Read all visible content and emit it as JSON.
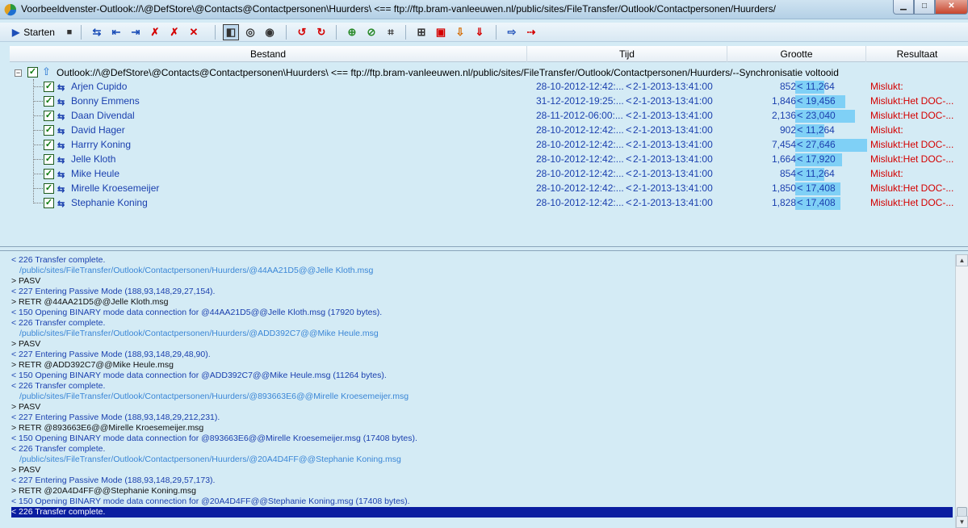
{
  "window": {
    "title": "Voorbeeldvenster-Outlook://\\@DefStore\\@Contacts@Contactpersonen\\Huurders\\ <== ftp://ftp.bram-vanleeuwen.nl/public/sites/FileTransfer/Outlook/Contactpersonen/Huurders/",
    "min_glyph": "▁",
    "max_glyph": "□",
    "close_glyph": "✕"
  },
  "toolbar": {
    "start_label": "Starten",
    "start_glyph": "▶",
    "stop_glyph": "■",
    "icons": [
      {
        "glyph": "⇆",
        "color": "#1d4fb8"
      },
      {
        "glyph": "⇤",
        "color": "#1d4fb8"
      },
      {
        "glyph": "⇥",
        "color": "#1d4fb8"
      },
      {
        "glyph": "✗",
        "color": "#d40000"
      },
      {
        "glyph": "✗",
        "color": "#d40000"
      },
      {
        "glyph": "✕",
        "color": "#d40000"
      },
      {
        "glyph": "◧",
        "color": "#333333"
      },
      {
        "glyph": "◎",
        "color": "#333333"
      },
      {
        "glyph": "◉",
        "color": "#333333"
      },
      {
        "glyph": "↺",
        "color": "#d40000"
      },
      {
        "glyph": "↻",
        "color": "#d40000"
      },
      {
        "glyph": "⊕",
        "color": "#2a8a2a"
      },
      {
        "glyph": "⊘",
        "color": "#2a8a2a"
      },
      {
        "glyph": "⌗",
        "color": "#333333"
      },
      {
        "glyph": "⊞",
        "color": "#333333"
      },
      {
        "glyph": "▣",
        "color": "#d40000"
      },
      {
        "glyph": "⇩",
        "color": "#d46a00"
      },
      {
        "glyph": "⇓",
        "color": "#d40000"
      },
      {
        "glyph": "⇨",
        "color": "#1d4fb8"
      },
      {
        "glyph": "⇢",
        "color": "#d40000"
      }
    ]
  },
  "columns": {
    "bestand": "Bestand",
    "tijd": "Tijd",
    "grootte": "Grootte",
    "resultaat": "Resultaat"
  },
  "tree": {
    "root_label": "Outlook://\\@DefStore\\@Contacts@Contactpersonen\\Huurders\\ <== ftp://ftp.bram-vanleeuwen.nl/public/sites/FileTransfer/Outlook/Contactpersonen/Huurders/--Synchronisatie voltooid",
    "expander": "−",
    "check": "✓",
    "up_arrow": "⇧",
    "sync_glyph": "⇆",
    "lt_glyph": "<",
    "rows": [
      {
        "name": "Arjen Cupido",
        "time_local": "28-10-2012-12:42:...",
        "time_remote": "2-1-2013-13:41:00",
        "size_local": "852",
        "size_remote": "11,264",
        "result": "Mislukt:",
        "fill": 0.41
      },
      {
        "name": "Bonny Emmens",
        "time_local": "31-12-2012-19:25:...",
        "time_remote": "2-1-2013-13:41:00",
        "size_local": "1,846",
        "size_remote": "19,456",
        "result": "Mislukt:Het DOC-...",
        "fill": 0.7
      },
      {
        "name": "Daan Divendal",
        "time_local": "28-11-2012-06:00:...",
        "time_remote": "2-1-2013-13:41:00",
        "size_local": "2,136",
        "size_remote": "23,040",
        "result": "Mislukt:Het DOC-...",
        "fill": 0.83
      },
      {
        "name": "David Hager",
        "time_local": "28-10-2012-12:42:...",
        "time_remote": "2-1-2013-13:41:00",
        "size_local": "902",
        "size_remote": "11,264",
        "result": "Mislukt:",
        "fill": 0.41
      },
      {
        "name": "Harrry Koning",
        "time_local": "28-10-2012-12:42:...",
        "time_remote": "2-1-2013-13:41:00",
        "size_local": "7,454",
        "size_remote": "27,646",
        "result": "Mislukt:Het DOC-...",
        "fill": 1.0
      },
      {
        "name": "Jelle Kloth",
        "time_local": "28-10-2012-12:42:...",
        "time_remote": "2-1-2013-13:41:00",
        "size_local": "1,664",
        "size_remote": "17,920",
        "result": "Mislukt:Het DOC-...",
        "fill": 0.65
      },
      {
        "name": "Mike Heule",
        "time_local": "28-10-2012-12:42:...",
        "time_remote": "2-1-2013-13:41:00",
        "size_local": "854",
        "size_remote": "11,264",
        "result": "Mislukt:",
        "fill": 0.41
      },
      {
        "name": "Mirelle Kroesemeijer",
        "time_local": "28-10-2012-12:42:...",
        "time_remote": "2-1-2013-13:41:00",
        "size_local": "1,850",
        "size_remote": "17,408",
        "result": "Mislukt:Het DOC-...",
        "fill": 0.63
      },
      {
        "name": "Stephanie Koning",
        "time_local": "28-10-2012-12:42:...",
        "time_remote": "2-1-2013-13:41:00",
        "size_local": "1,828",
        "size_remote": "17,408",
        "result": "Mislukt:Het DOC-...",
        "fill": 0.63
      }
    ]
  },
  "log": [
    {
      "kind": "resp",
      "text": "< 226 Transfer complete."
    },
    {
      "kind": "path",
      "text": "/public/sites/FileTransfer/Outlook/Contactpersonen/Huurders/@44AA21D5@@Jelle Kloth.msg"
    },
    {
      "kind": "cmd",
      "text": "> PASV"
    },
    {
      "kind": "resp",
      "text": "< 227 Entering Passive Mode (188,93,148,29,27,154)."
    },
    {
      "kind": "cmd",
      "text": "> RETR @44AA21D5@@Jelle Kloth.msg"
    },
    {
      "kind": "resp",
      "text": "< 150 Opening BINARY mode data connection for @44AA21D5@@Jelle Kloth.msg (17920 bytes)."
    },
    {
      "kind": "resp",
      "text": "< 226 Transfer complete."
    },
    {
      "kind": "path",
      "text": "/public/sites/FileTransfer/Outlook/Contactpersonen/Huurders/@ADD392C7@@Mike Heule.msg"
    },
    {
      "kind": "cmd",
      "text": "> PASV"
    },
    {
      "kind": "resp",
      "text": "< 227 Entering Passive Mode (188,93,148,29,48,90)."
    },
    {
      "kind": "cmd",
      "text": "> RETR @ADD392C7@@Mike Heule.msg"
    },
    {
      "kind": "resp",
      "text": "< 150 Opening BINARY mode data connection for @ADD392C7@@Mike Heule.msg (11264 bytes)."
    },
    {
      "kind": "resp",
      "text": "< 226 Transfer complete."
    },
    {
      "kind": "path",
      "text": "/public/sites/FileTransfer/Outlook/Contactpersonen/Huurders/@893663E6@@Mirelle Kroesemeijer.msg"
    },
    {
      "kind": "cmd",
      "text": "> PASV"
    },
    {
      "kind": "resp",
      "text": "< 227 Entering Passive Mode (188,93,148,29,212,231)."
    },
    {
      "kind": "cmd",
      "text": "> RETR @893663E6@@Mirelle Kroesemeijer.msg"
    },
    {
      "kind": "resp",
      "text": "< 150 Opening BINARY mode data connection for @893663E6@@Mirelle Kroesemeijer.msg (17408 bytes)."
    },
    {
      "kind": "resp",
      "text": "< 226 Transfer complete."
    },
    {
      "kind": "path",
      "text": "/public/sites/FileTransfer/Outlook/Contactpersonen/Huurders/@20A4D4FF@@Stephanie Koning.msg"
    },
    {
      "kind": "cmd",
      "text": "> PASV"
    },
    {
      "kind": "resp",
      "text": "< 227 Entering Passive Mode (188,93,148,29,57,173)."
    },
    {
      "kind": "cmd",
      "text": "> RETR @20A4D4FF@@Stephanie Koning.msg"
    },
    {
      "kind": "resp",
      "text": "< 150 Opening BINARY mode data connection for @20A4D4FF@@Stephanie Koning.msg (17408 bytes)."
    },
    {
      "kind": "selected",
      "text": "< 226 Transfer complete."
    }
  ],
  "scrollbar": {
    "up_glyph": "▲",
    "down_glyph": "▼"
  }
}
